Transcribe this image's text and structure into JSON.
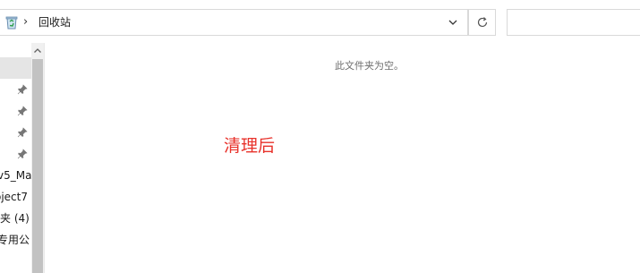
{
  "address_bar": {
    "location": "回收站",
    "separator": "›",
    "icon": "recycle-bin-icon",
    "dropdown_icon": "chevron-down-icon"
  },
  "toolbar": {
    "refresh_icon": "refresh-icon",
    "search_placeholder": ""
  },
  "nav_pane": {
    "pinned_items_count": 4,
    "items": [
      {
        "label": "v5_Ma"
      },
      {
        "label": "oject7"
      },
      {
        "label": "夹 (4)"
      },
      {
        "label": "专用公"
      }
    ]
  },
  "main": {
    "empty_message": "此文件夹为空。",
    "annotation": "清理后"
  },
  "colors": {
    "annotation": "#e8322b",
    "border": "#d9d9d9",
    "selection": "#e5e5e5",
    "scrollbar_thumb": "#c2c2c2"
  }
}
